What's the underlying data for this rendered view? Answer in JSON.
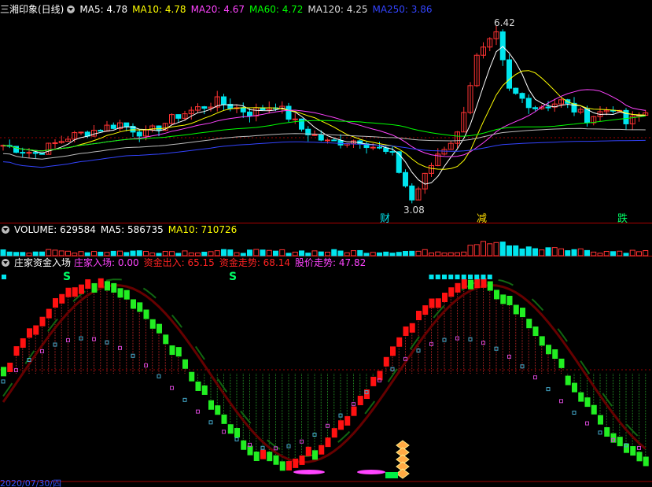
{
  "panels": {
    "price": {
      "title": "三湘印象(日线)",
      "ma": [
        {
          "label": "MA5: 4.78",
          "color": "#ffffff"
        },
        {
          "label": "MA10: 4.78",
          "color": "#ffff00"
        },
        {
          "label": "MA20: 4.67",
          "color": "#ff44ff"
        },
        {
          "label": "MA60: 4.72",
          "color": "#00ff00"
        },
        {
          "label": "MA120: 4.25",
          "color": "#dddddd"
        },
        {
          "label": "MA250: 3.86",
          "color": "#3344ff"
        }
      ],
      "high_label": "6.42",
      "low_label": "3.08",
      "markers": [
        "财",
        "减",
        "跌"
      ]
    },
    "volume": {
      "labels": [
        {
          "label": "VOLUME: 629584",
          "color": "#ffffff"
        },
        {
          "label": "MA5: 586735",
          "color": "#ffffff"
        },
        {
          "label": "MA10: 710726",
          "color": "#ffff00"
        }
      ]
    },
    "indicator": {
      "title": "庄家资金入场",
      "labels": [
        {
          "label": "庄家入场: 0.00",
          "color": "#ff44ff"
        },
        {
          "label": "资金出入: 65.15",
          "color": "#ff2222"
        },
        {
          "label": "资金走势: 68.14",
          "color": "#ff2222"
        },
        {
          "label": "股价走势: 47.82",
          "color": "#ff44ff"
        }
      ],
      "s_marks": [
        "S",
        "S"
      ]
    },
    "date_label": "2020/07/30/四"
  },
  "colors": {
    "up": "#ff3333",
    "down": "#00e5ee",
    "grid": "#a00000"
  },
  "chart_data": {
    "type": "candlestick",
    "title": "三湘印象(日线)",
    "price_max": 6.42,
    "price_min": 3.08,
    "indicator_values": {
      "庄家入场": 0.0,
      "资金出入": 65.15,
      "资金走势": 68.14,
      "股价走势": 47.82
    },
    "volume": {
      "VOLUME": 629584,
      "MA5": 586735,
      "MA10": 710726
    }
  }
}
